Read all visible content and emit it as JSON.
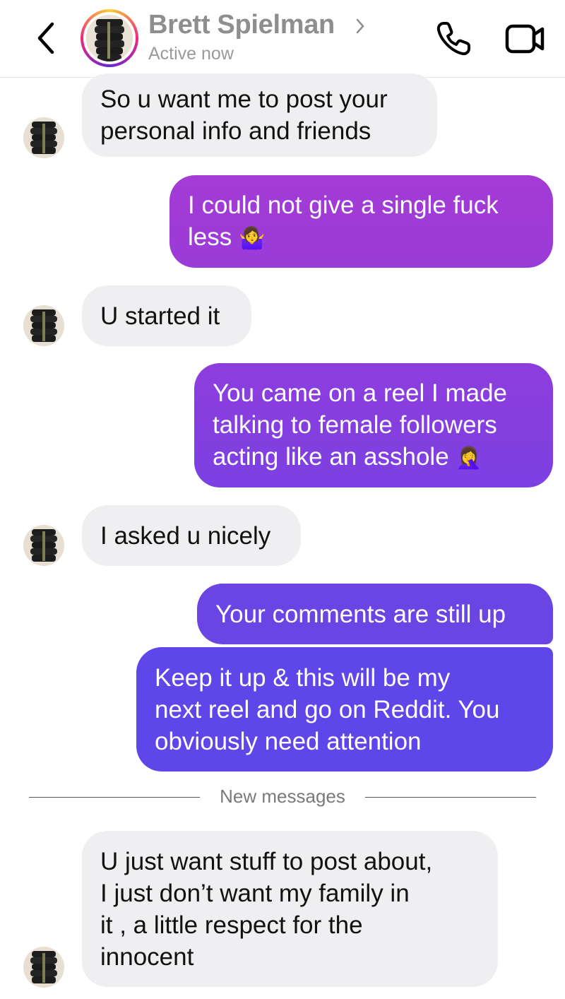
{
  "header": {
    "contact_name": "Brett Spielman",
    "status": "Active now",
    "icons": [
      "chevron-left-icon",
      "chevron-right-icon",
      "phone-icon",
      "video-camera-icon"
    ]
  },
  "messages": [
    {
      "direction": "received",
      "text": "So u want me to post your\npersonal info and friends"
    },
    {
      "direction": "sent",
      "text": "I could not give a single fuck\nless",
      "emoji": "🤷‍♀️"
    },
    {
      "direction": "received",
      "text": "U started it"
    },
    {
      "direction": "sent",
      "text": "You came on a reel I made\ntalking to female followers\nacting like an asshole",
      "emoji": "🤦‍♀️"
    },
    {
      "direction": "received",
      "text": "I asked u nicely"
    },
    {
      "direction": "sent",
      "text": "Your comments are still up"
    },
    {
      "direction": "sent",
      "text": "Keep it up & this will be my\nnext reel and go on Reddit. You\nobviously need attention"
    },
    {
      "direction": "received",
      "text": "U just want stuff to post about,\nI just don’t want my family in\nit , a little respect for the\ninnocent"
    }
  ],
  "divider": {
    "label": "New messages"
  },
  "colors": {
    "received_bubble": "#efeff1",
    "sent_gradient_top": "#a23ad3",
    "sent_gradient_bottom": "#5b45e8"
  }
}
